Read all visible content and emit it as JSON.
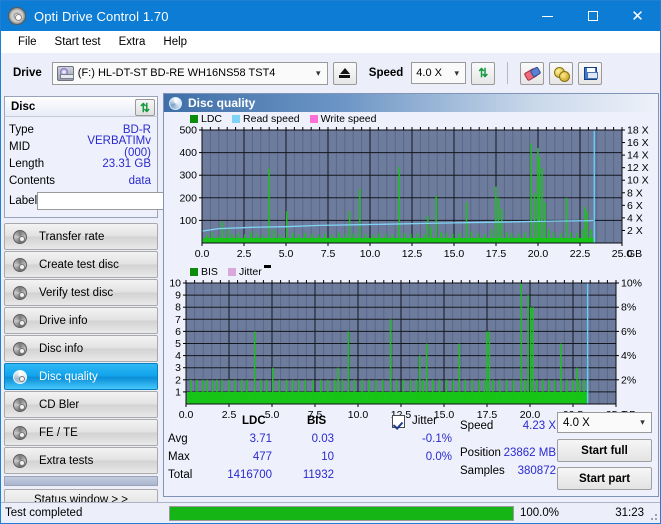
{
  "window": {
    "title": "Opti Drive Control 1.70",
    "icon": "disc-icon",
    "minimize": "–",
    "maximize": "□",
    "close": "✕"
  },
  "menu": {
    "items": [
      "File",
      "Start test",
      "Extra",
      "Help"
    ]
  },
  "toolbar": {
    "drive_label": "Drive",
    "drive_value": "(F:)  HL-DT-ST BD-RE  WH16NS58 TST4",
    "eject_title": "eject-icon",
    "speed_label": "Speed",
    "speed_value": "4.0 X",
    "icons": [
      "refresh-icon",
      "eraser-icon",
      "gold-discs-icon",
      "save-icon"
    ]
  },
  "disc": {
    "header": "Disc",
    "refresh_icon": "refresh-icon",
    "rows": [
      {
        "key": "Type",
        "value": "BD-R"
      },
      {
        "key": "MID",
        "value": "VERBATIMv (000)"
      },
      {
        "key": "Length",
        "value": "23.31 GB"
      },
      {
        "key": "Contents",
        "value": "data"
      }
    ],
    "label_key": "Label",
    "label_value": "",
    "label_placeholder": ""
  },
  "sidebar": {
    "items": [
      {
        "label": "Transfer rate",
        "active": false
      },
      {
        "label": "Create test disc",
        "active": false
      },
      {
        "label": "Verify test disc",
        "active": false
      },
      {
        "label": "Drive info",
        "active": false
      },
      {
        "label": "Disc info",
        "active": false
      },
      {
        "label": "Disc quality",
        "active": true
      },
      {
        "label": "CD Bler",
        "active": false
      },
      {
        "label": "FE / TE",
        "active": false
      },
      {
        "label": "Extra tests",
        "active": false
      }
    ],
    "status_window": "Status window > >"
  },
  "content": {
    "title": "Disc quality",
    "icon": "disc-icon"
  },
  "stats": {
    "col_ldc": "LDC",
    "col_bis": "BIS",
    "jitter_label": "Jitter",
    "jitter_checked": true,
    "row_avg": "Avg",
    "row_max": "Max",
    "row_total": "Total",
    "avg_ldc": "3.71",
    "avg_bis": "0.03",
    "avg_jitter": "-0.1%",
    "max_ldc": "477",
    "max_bis": "10",
    "max_jitter": "0.0%",
    "total_ldc": "1416700",
    "total_bis": "11932",
    "speed_label": "Speed",
    "speed_value": "4.23 X",
    "position_label": "Position",
    "position_value": "23862 MB",
    "samples_label": "Samples",
    "samples_value": "380872",
    "speed_select": "4.0 X",
    "start_full": "Start full",
    "start_part": "Start part"
  },
  "statusbar": {
    "text": "Test completed",
    "percent": "100.0%",
    "progress": 100,
    "elapsed": "31:23"
  },
  "colors": {
    "accent": "#0c7cd5",
    "plot_bg": "#6d7c9c",
    "ldc_green": "#17c417",
    "read_speed": "#7fd4f5",
    "write_speed": "#ff6fd8",
    "bis_green": "#17c417",
    "jitter_pink": "#d9a8d9",
    "value_blue": "#2a2ad0",
    "progress_green": "#16b516"
  },
  "chart_data": [
    {
      "type": "line",
      "title": "LDC / Read speed",
      "xlabel": "GB",
      "ylabel": "LDC",
      "xlim": [
        0,
        25
      ],
      "ylim": [
        0,
        500
      ],
      "y2lim": [
        0,
        18
      ],
      "y2label": "X",
      "grid": true,
      "legend": [
        "LDC",
        "Read speed",
        "Write speed"
      ],
      "legend_position": "top-left",
      "xticks": [
        "0.0",
        "2.5",
        "5.0",
        "7.5",
        "10.0",
        "12.5",
        "15.0",
        "17.5",
        "20.0",
        "22.5",
        "25.0"
      ],
      "yticks": [
        100,
        200,
        300,
        400,
        500
      ],
      "y2ticks": [
        "2 X",
        "4 X",
        "6 X",
        "8 X",
        "10 X",
        "12 X",
        "14 X",
        "16 X",
        "18 X"
      ],
      "data_end_gb": 23.3,
      "series": [
        {
          "name": "LDC",
          "color": "#17c417",
          "kind": "spikes",
          "baseline": 22,
          "spikes": [
            [
              0.25,
              35
            ],
            [
              0.55,
              48
            ],
            [
              0.9,
              30
            ],
            [
              1.15,
              95
            ],
            [
              1.5,
              60
            ],
            [
              1.75,
              40
            ],
            [
              2.1,
              44
            ],
            [
              2.5,
              38
            ],
            [
              2.9,
              52
            ],
            [
              3.2,
              42
            ],
            [
              3.55,
              36
            ],
            [
              3.95,
              330
            ],
            [
              4.25,
              60
            ],
            [
              4.6,
              40
            ],
            [
              5.0,
              140
            ],
            [
              5.35,
              46
            ],
            [
              5.7,
              38
            ],
            [
              6.1,
              44
            ],
            [
              6.5,
              40
            ],
            [
              6.9,
              36
            ],
            [
              7.3,
              42
            ],
            [
              7.7,
              38
            ],
            [
              8.1,
              46
            ],
            [
              8.5,
              40
            ],
            [
              8.75,
              140
            ],
            [
              9.0,
              44
            ],
            [
              9.35,
              240
            ],
            [
              9.7,
              40
            ],
            [
              10.1,
              38
            ],
            [
              10.5,
              44
            ],
            [
              10.9,
              40
            ],
            [
              11.3,
              38
            ],
            [
              11.7,
              335
            ],
            [
              12.0,
              46
            ],
            [
              12.4,
              40
            ],
            [
              12.8,
              44
            ],
            [
              13.2,
              38
            ],
            [
              13.4,
              120
            ],
            [
              13.6,
              70
            ],
            [
              13.9,
              210
            ],
            [
              14.2,
              50
            ],
            [
              14.5,
              44
            ],
            [
              14.9,
              40
            ],
            [
              15.3,
              46
            ],
            [
              15.7,
              180
            ],
            [
              16.0,
              52
            ],
            [
              16.4,
              44
            ],
            [
              16.8,
              40
            ],
            [
              17.2,
              60
            ],
            [
              17.45,
              250
            ],
            [
              17.6,
              200
            ],
            [
              17.8,
              150
            ],
            [
              18.1,
              48
            ],
            [
              18.4,
              44
            ],
            [
              18.8,
              40
            ],
            [
              19.2,
              48
            ],
            [
              19.55,
              440
            ],
            [
              19.75,
              220
            ],
            [
              19.95,
              420
            ],
            [
              20.05,
              380
            ],
            [
              20.2,
              330
            ],
            [
              20.35,
              180
            ],
            [
              20.6,
              60
            ],
            [
              20.9,
              48
            ],
            [
              21.3,
              44
            ],
            [
              21.65,
              200
            ],
            [
              21.9,
              48
            ],
            [
              22.3,
              44
            ],
            [
              22.6,
              60
            ],
            [
              22.75,
              160
            ],
            [
              22.9,
              140
            ],
            [
              23.1,
              60
            ],
            [
              23.3,
              50
            ]
          ]
        },
        {
          "name": "Read speed",
          "color": "#7fd4f5",
          "kind": "line",
          "points": [
            [
              0.0,
              1.9
            ],
            [
              1.0,
              2.3
            ],
            [
              3.0,
              2.5
            ],
            [
              5.0,
              2.6
            ],
            [
              7.0,
              2.8
            ],
            [
              9.0,
              2.9
            ],
            [
              11.0,
              3.0
            ],
            [
              13.0,
              3.1
            ],
            [
              15.0,
              3.2
            ],
            [
              17.0,
              3.3
            ],
            [
              19.0,
              3.4
            ],
            [
              21.0,
              3.5
            ],
            [
              23.0,
              3.55
            ],
            [
              23.3,
              3.6
            ]
          ],
          "axis": "secondary_scaled"
        },
        {
          "name": "Write speed",
          "color": "#ff6fd8",
          "kind": "line",
          "points": []
        }
      ],
      "vertical_marker_gb": 23.35
    },
    {
      "type": "line",
      "title": "BIS / Jitter",
      "xlabel": "GB",
      "ylabel": "BIS",
      "xlim": [
        0,
        25
      ],
      "ylim": [
        0,
        10
      ],
      "y2lim": [
        0,
        10
      ],
      "y2label": "%",
      "grid": true,
      "legend": [
        "BIS",
        "Jitter"
      ],
      "legend_position": "top-left",
      "xticks": [
        "0.0",
        "2.5",
        "5.0",
        "7.5",
        "10.0",
        "12.5",
        "15.0",
        "17.5",
        "20.0",
        "22.5",
        "25.0"
      ],
      "yticks": [
        1,
        2,
        3,
        4,
        5,
        6,
        7,
        8,
        9,
        10
      ],
      "y2ticks": [
        "2%",
        "4%",
        "6%",
        "8%",
        "10%"
      ],
      "data_end_gb": 23.3,
      "series": [
        {
          "name": "BIS",
          "color": "#17c417",
          "kind": "spikes",
          "baseline": 1,
          "spikes": [
            [
              0.25,
              2
            ],
            [
              0.6,
              2
            ],
            [
              0.95,
              2
            ],
            [
              1.2,
              2
            ],
            [
              1.5,
              2
            ],
            [
              1.75,
              2
            ],
            [
              2.05,
              2
            ],
            [
              2.45,
              2
            ],
            [
              2.8,
              2
            ],
            [
              3.2,
              2
            ],
            [
              3.5,
              2
            ],
            [
              3.95,
              6
            ],
            [
              4.3,
              2
            ],
            [
              4.65,
              2
            ],
            [
              5.0,
              3
            ],
            [
              5.4,
              2
            ],
            [
              5.8,
              2
            ],
            [
              6.15,
              2
            ],
            [
              6.5,
              2
            ],
            [
              6.9,
              2
            ],
            [
              7.35,
              2
            ],
            [
              7.8,
              2
            ],
            [
              8.2,
              2
            ],
            [
              8.6,
              2
            ],
            [
              8.8,
              3
            ],
            [
              9.05,
              2
            ],
            [
              9.4,
              6
            ],
            [
              9.75,
              2
            ],
            [
              10.2,
              2
            ],
            [
              10.6,
              2
            ],
            [
              11.0,
              2
            ],
            [
              11.4,
              2
            ],
            [
              11.85,
              7
            ],
            [
              12.2,
              2
            ],
            [
              12.6,
              2
            ],
            [
              13.0,
              2
            ],
            [
              13.35,
              2
            ],
            [
              13.55,
              4
            ],
            [
              13.75,
              2
            ],
            [
              13.95,
              5
            ],
            [
              14.3,
              2
            ],
            [
              14.7,
              2
            ],
            [
              15.1,
              2
            ],
            [
              15.5,
              2
            ],
            [
              15.85,
              5
            ],
            [
              16.2,
              2
            ],
            [
              16.6,
              2
            ],
            [
              17.0,
              2
            ],
            [
              17.3,
              2
            ],
            [
              17.45,
              6
            ],
            [
              17.6,
              6
            ],
            [
              17.8,
              2
            ],
            [
              18.2,
              2
            ],
            [
              18.6,
              2
            ],
            [
              19.0,
              2
            ],
            [
              19.45,
              10
            ],
            [
              19.65,
              2
            ],
            [
              19.85,
              9
            ],
            [
              20.0,
              8
            ],
            [
              20.15,
              8
            ],
            [
              20.35,
              2
            ],
            [
              20.7,
              2
            ],
            [
              21.05,
              2
            ],
            [
              21.4,
              2
            ],
            [
              21.75,
              5
            ],
            [
              22.1,
              2
            ],
            [
              22.45,
              2
            ],
            [
              22.7,
              3
            ],
            [
              22.85,
              2
            ],
            [
              23.1,
              2
            ],
            [
              23.3,
              2
            ]
          ]
        },
        {
          "name": "Jitter",
          "color": "#d9a8d9",
          "kind": "line",
          "points": []
        }
      ],
      "vertical_marker_gb": 23.35
    }
  ]
}
